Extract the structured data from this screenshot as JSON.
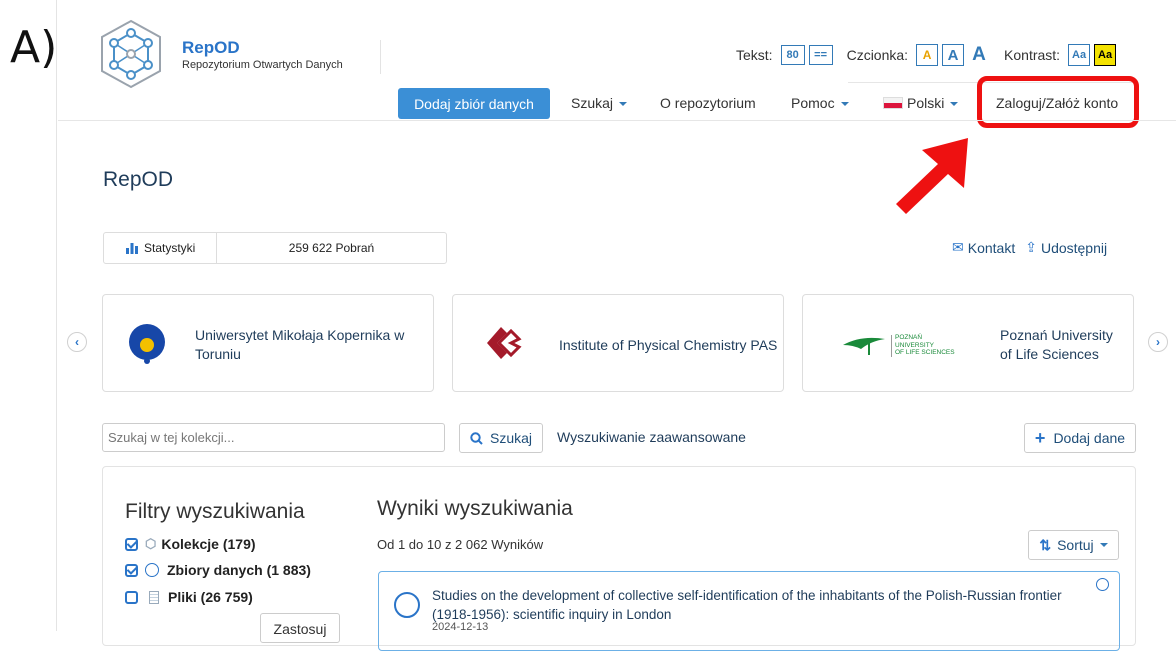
{
  "panel_label": "A)",
  "brand": {
    "title": "RepOD",
    "subtitle": "Repozytorium Otwartych Danych"
  },
  "accessibility": {
    "text_label": "Tekst:",
    "text_size": "80",
    "text_spacing": "==",
    "font_label": "Czcionka:",
    "font_options": [
      "A",
      "A",
      "A"
    ],
    "contrast_label": "Kontrast:",
    "contrast_options": [
      "Aa",
      "Aa"
    ]
  },
  "nav": {
    "add_dataset": "Dodaj zbiór danych",
    "search": "Szukaj",
    "about": "O repozytorium",
    "help": "Pomoc",
    "language": "Polski",
    "login": "Zaloguj/Załóż konto"
  },
  "page_title": "RepOD",
  "stats": {
    "label": "Statystyki",
    "downloads": "259 622 Pobrań"
  },
  "actions": {
    "contact": "Kontakt",
    "share": "Udostępnij"
  },
  "institutions": [
    {
      "name": "Uniwersytet Mikołaja Kopernika w Toruniu"
    },
    {
      "name": "Institute of Physical Chemistry PAS"
    },
    {
      "name": "Poznań University of Life Sciences",
      "logo_lines": [
        "POZNAŃ",
        "UNIVERSITY",
        "OF LIFE SCIENCES"
      ]
    }
  ],
  "search": {
    "placeholder": "Szukaj w tej kolekcji...",
    "button": "Szukaj",
    "advanced": "Wyszukiwanie zaawansowane",
    "add_data": "Dodaj dane"
  },
  "filters": {
    "title": "Filtry wyszukiwania",
    "items": [
      {
        "label": "Kolekcje (179)",
        "checked": true
      },
      {
        "label": "Zbiory danych (1 883)",
        "checked": true
      },
      {
        "label": "Pliki (26 759)",
        "checked": false
      }
    ],
    "apply": "Zastosuj"
  },
  "results": {
    "title": "Wyniki wyszukiwania",
    "count": "Od 1 do 10 z 2 062 Wyników",
    "sort": "Sortuj",
    "items": [
      {
        "title": "Studies on the development of collective self-identification of the inhabitants of the Polish-Russian frontier (1918-1956): scientific inquiry in London",
        "date": "2024-12-13"
      }
    ]
  },
  "colors": {
    "accent": "#3b8fd6",
    "highlight": "#ee1111",
    "link": "#1f4e79"
  }
}
